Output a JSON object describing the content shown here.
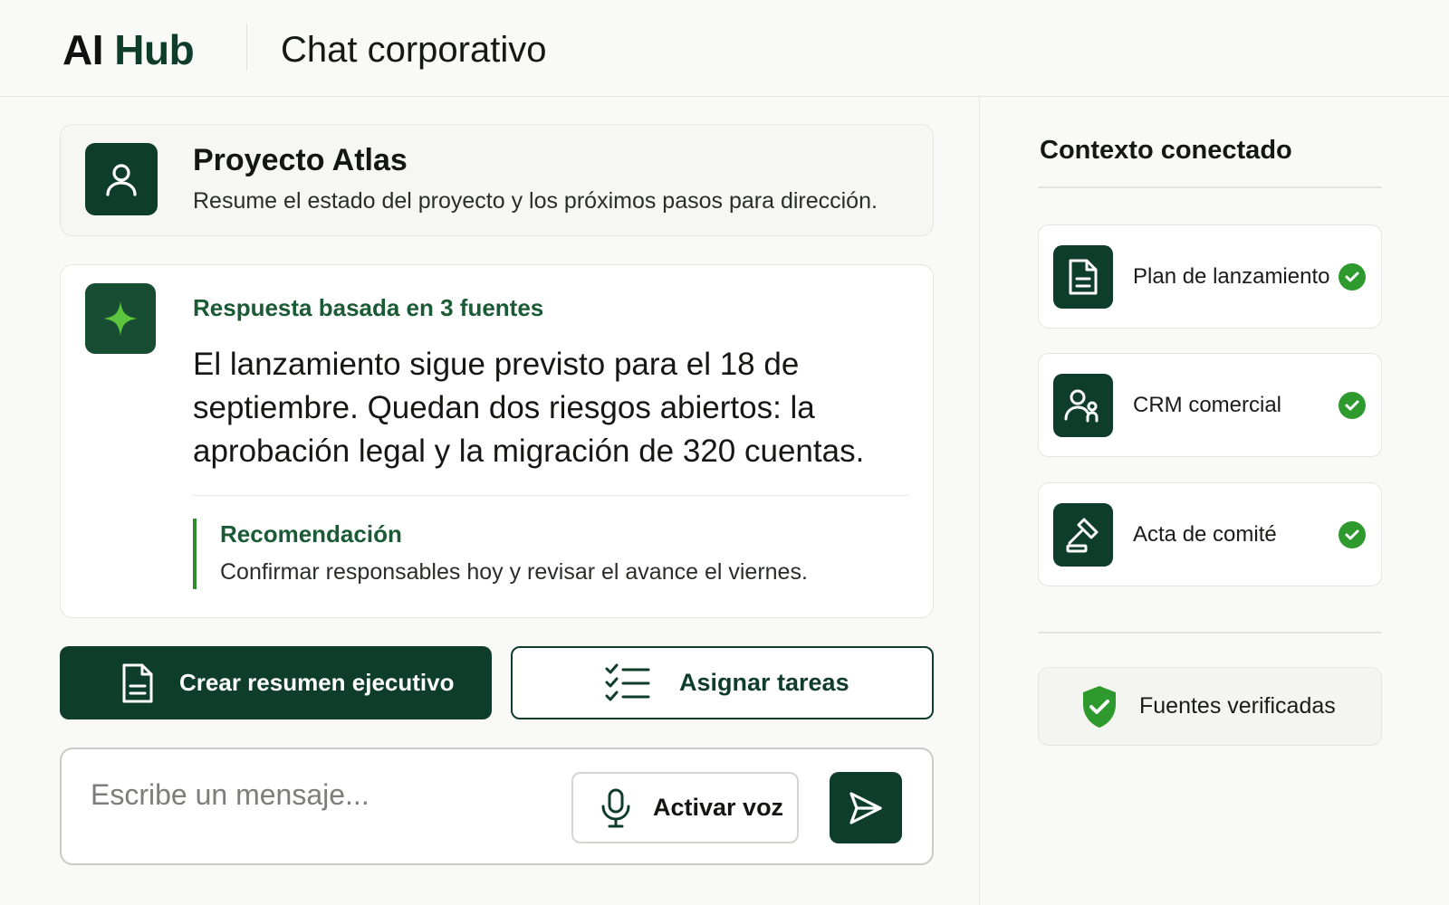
{
  "header": {
    "logo_ai": "AI",
    "logo_hub": "Hub",
    "title": "Chat corporativo"
  },
  "prompt": {
    "avatar_icon": "user-icon",
    "title": "Proyecto Atlas",
    "text": "Resume el estado del proyecto y los próximos pasos para dirección."
  },
  "answer": {
    "avatar_icon": "sparkle-icon",
    "sources_label": "Respuesta basada en 3 fuentes",
    "text": "El lanzamiento sigue previsto para el 18 de septiembre. Quedan dos riesgos abiertos: la aprobación legal y la migración de 320 cuentas.",
    "recommendation_title": "Recomendación",
    "recommendation_text": "Confirmar responsables hoy y revisar el avance el viernes."
  },
  "actions": {
    "primary_label": "Crear resumen ejecutivo",
    "primary_icon": "document-icon",
    "secondary_label": "Asignar tareas",
    "secondary_icon": "checklist-icon"
  },
  "composer": {
    "placeholder": "Escribe un mensaje...",
    "voice_label": "Activar voz",
    "voice_icon": "microphone-icon",
    "send_icon": "send-icon"
  },
  "sidebar": {
    "title": "Contexto conectado",
    "sources": [
      {
        "label": "Plan de lanzamiento",
        "icon": "document-icon",
        "status": "connected"
      },
      {
        "label": "CRM comercial",
        "icon": "users-icon",
        "status": "connected"
      },
      {
        "label": "Acta de comité",
        "icon": "gavel-icon",
        "status": "connected"
      }
    ],
    "verified_label": "Fuentes verificadas",
    "verified_icon": "shield-check-icon"
  },
  "colors": {
    "brand_dark": "#0f3d2b",
    "accent_green": "#2e9a2e",
    "text_green": "#1a5a35"
  }
}
